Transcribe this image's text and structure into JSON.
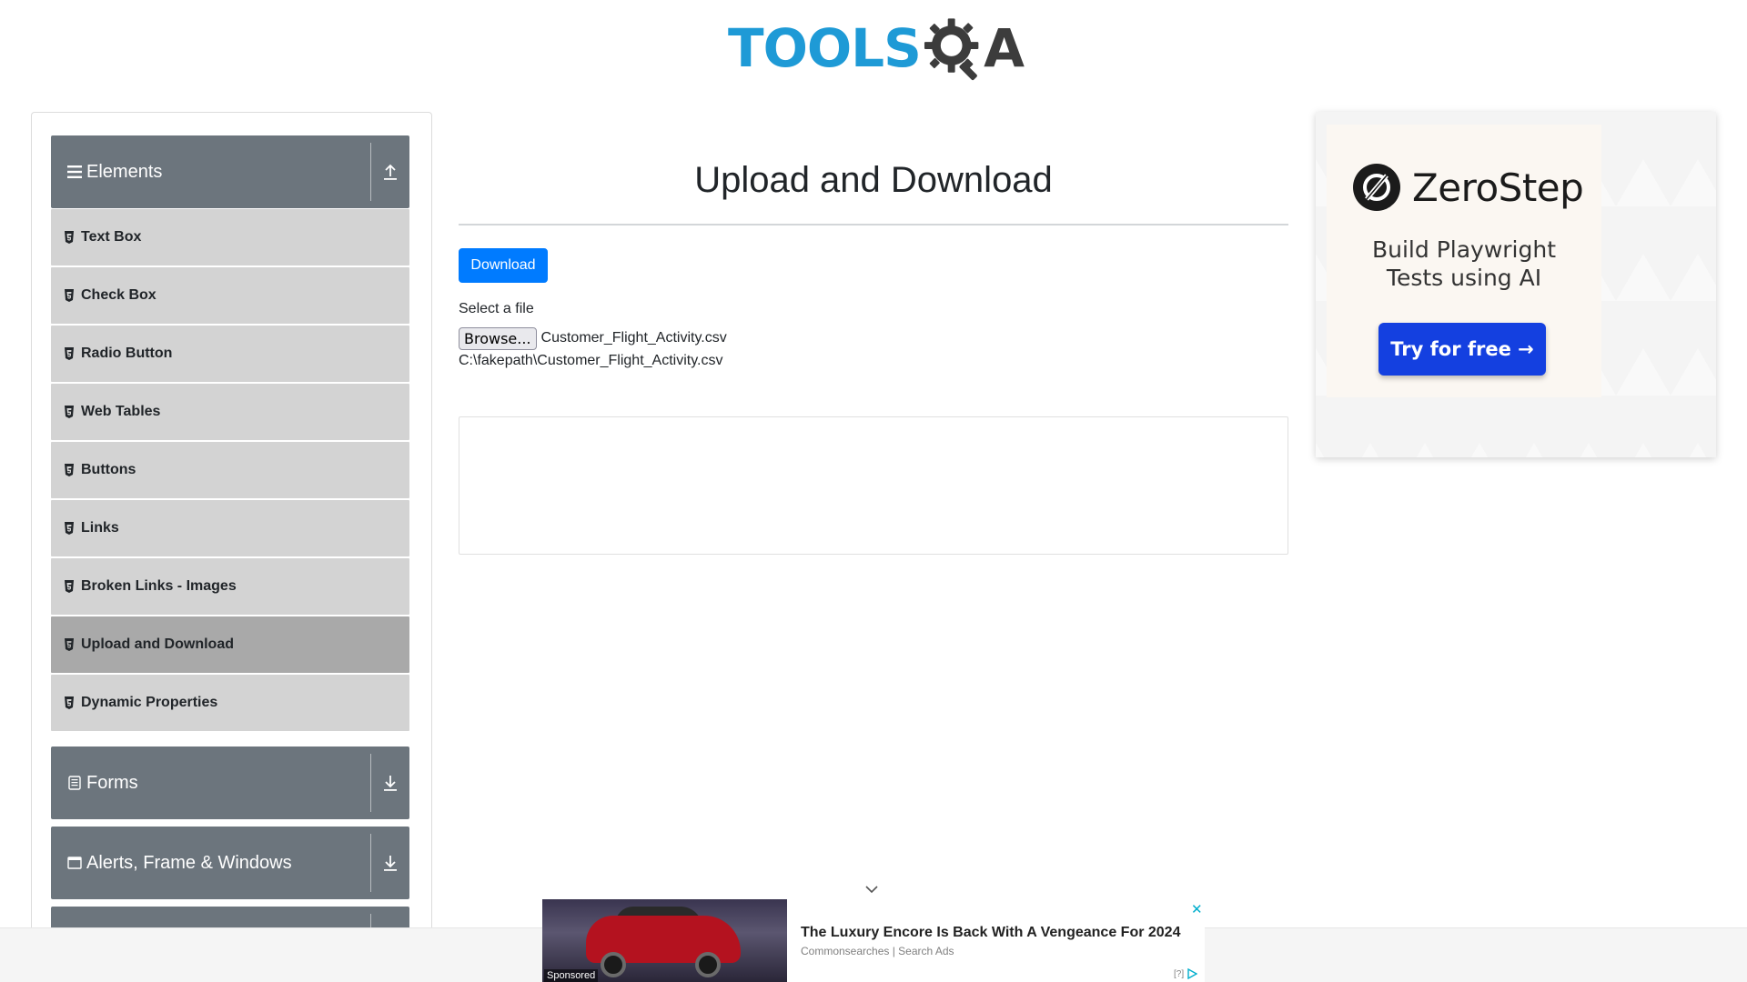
{
  "logo": {
    "part1": "TOOLS",
    "part2": "QA",
    "letter_a": "A"
  },
  "sidebar": {
    "groups": [
      {
        "label": "Elements",
        "icon": "hamburger-icon",
        "toggle_icon": "upload-arrow-icon"
      },
      {
        "label": "Forms",
        "icon": "form-icon",
        "toggle_icon": "download-arrow-icon"
      },
      {
        "label": "Alerts, Frame & Windows",
        "icon": "window-icon",
        "toggle_icon": "download-arrow-icon"
      },
      {
        "label": "",
        "icon": "",
        "toggle_icon": ""
      }
    ],
    "items": [
      {
        "label": "Text Box",
        "active": false
      },
      {
        "label": "Check Box",
        "active": false
      },
      {
        "label": "Radio Button",
        "active": false
      },
      {
        "label": "Web Tables",
        "active": false
      },
      {
        "label": "Buttons",
        "active": false
      },
      {
        "label": "Links",
        "active": false
      },
      {
        "label": "Broken Links - Images",
        "active": false
      },
      {
        "label": "Upload and Download",
        "active": true
      },
      {
        "label": "Dynamic Properties",
        "active": false
      }
    ]
  },
  "main": {
    "title": "Upload and Download",
    "download_label": "Download",
    "select_label": "Select a file",
    "browse_label": "Browse...",
    "selected_file": "Customer_Flight_Activity.csv",
    "uploaded_path": "C:\\fakepath\\Customer_Flight_Activity.csv"
  },
  "ad_right": {
    "brand": "ZeroStep",
    "tagline_line1": "Build Playwright",
    "tagline_line2": "Tests using AI",
    "cta": "Try for free →"
  },
  "bottom_ad": {
    "sponsored": "Sponsored",
    "headline": "The Luxury Encore Is Back With A Vengeance For 2024",
    "source": "Commonsearches | Search Ads",
    "choices": "[?]",
    "close": "✕"
  },
  "colors": {
    "primary": "#007bff",
    "group_header": "#6c757d",
    "menu_item": "#d3d3d3",
    "menu_item_active": "#a9a9a9",
    "logo_blue": "#1e9ad6",
    "cta_blue": "#1440e0"
  }
}
